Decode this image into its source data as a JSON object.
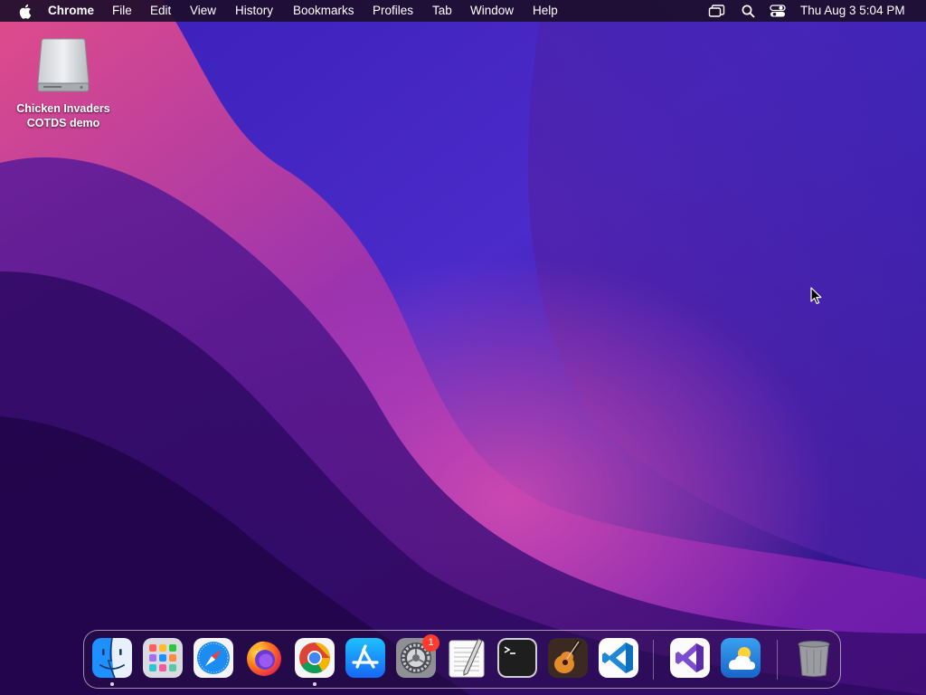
{
  "menubar": {
    "app_name": "Chrome",
    "items": [
      "File",
      "Edit",
      "View",
      "History",
      "Bookmarks",
      "Profiles",
      "Tab",
      "Window",
      "Help"
    ],
    "clock": "Thu Aug 3  5:04 PM"
  },
  "desktop": {
    "icon_label_line1": "Chicken Invaders",
    "icon_label_line2": "COTDS demo"
  },
  "dock": {
    "settings_badge": "1",
    "apps": [
      "Finder",
      "Launchpad",
      "Safari",
      "Firefox",
      "Google Chrome",
      "App Store",
      "System Settings",
      "TextEdit",
      "Terminal",
      "GarageBand",
      "Visual Studio Code",
      "Visual Studio",
      "Weather",
      "Trash"
    ]
  },
  "colors": {
    "menubar_bg": "#1c0e2c",
    "wallpaper_dark": "#220a4e",
    "wallpaper_magenta": "#c0359a",
    "badge": "#ff3b30"
  }
}
